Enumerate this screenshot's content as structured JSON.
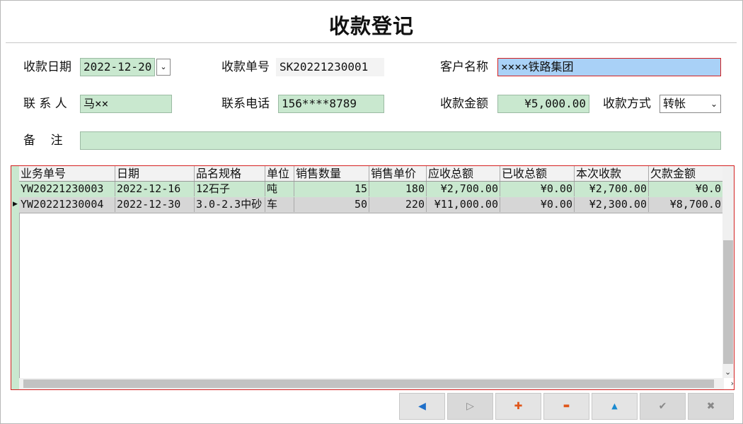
{
  "title": "收款登记",
  "form": {
    "date_label": "收款日期",
    "date_value": "2022-12-20",
    "receipt_no_label": "收款单号",
    "receipt_no_value": "SK20221230001",
    "customer_label": "客户名称",
    "customer_value": "××××铁路集团",
    "contact_label": "联 系 人",
    "contact_value": "马××",
    "phone_label": "联系电话",
    "phone_value": "156****8789",
    "amount_label": "收款金额",
    "amount_value": "¥5,000.00",
    "method_label": "收款方式",
    "method_value": "转帐",
    "remark_label": "备    注",
    "remark_value": ""
  },
  "grid": {
    "headers": [
      "业务单号",
      "日期",
      "品名规格",
      "单位",
      "销售数量",
      "销售单价",
      "应收总额",
      "已收总额",
      "本次收款",
      "欠款金额"
    ],
    "rows": [
      [
        "YW20221230003",
        "2022-12-16",
        "12石子",
        "吨",
        "15",
        "180",
        "¥2,700.00",
        "¥0.00",
        "¥2,700.00",
        "¥0.0"
      ],
      [
        "YW20221230004",
        "2022-12-30",
        "3.0-2.3中砂",
        "车",
        "50",
        "220",
        "¥11,000.00",
        "¥0.00",
        "¥2,300.00",
        "¥8,700.0"
      ]
    ]
  },
  "toolbar": {
    "prev_icon": "◀",
    "next_icon": "▷",
    "add_icon": "✚",
    "delete_icon": "▬",
    "up_icon": "▲",
    "confirm_icon": "✔",
    "close_icon": "✖"
  },
  "colors": {
    "field_bg": "#c9e8cf",
    "selected_bg": "#a9d1f7",
    "focus_border": "#d42020"
  }
}
